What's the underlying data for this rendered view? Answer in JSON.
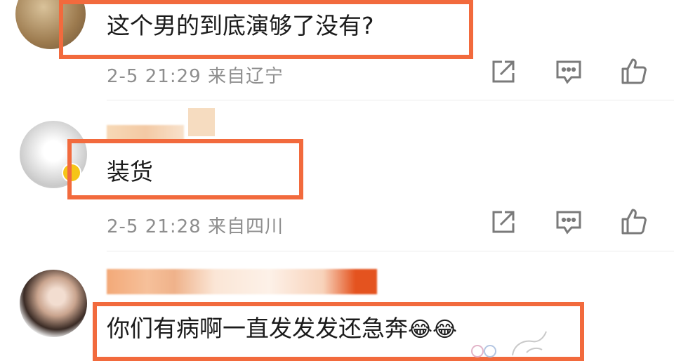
{
  "comments": [
    {
      "text": "这个男的到底演够了没有?",
      "time": "2-5 21:29",
      "location": "来自辽宁"
    },
    {
      "text": "装货",
      "time": "2-5 21:28",
      "location": "来自四川"
    },
    {
      "text": "你们有病啊一直发发发还急奔",
      "emoji": "😂😂"
    }
  ],
  "icons": {
    "share": "share-icon",
    "reply": "comment-icon",
    "like": "like-icon"
  },
  "colors": {
    "highlight": "#f26a3d",
    "meta_text": "#8e8e8e",
    "icon": "#7a7a7a",
    "verified_badge": "#f5c518"
  }
}
